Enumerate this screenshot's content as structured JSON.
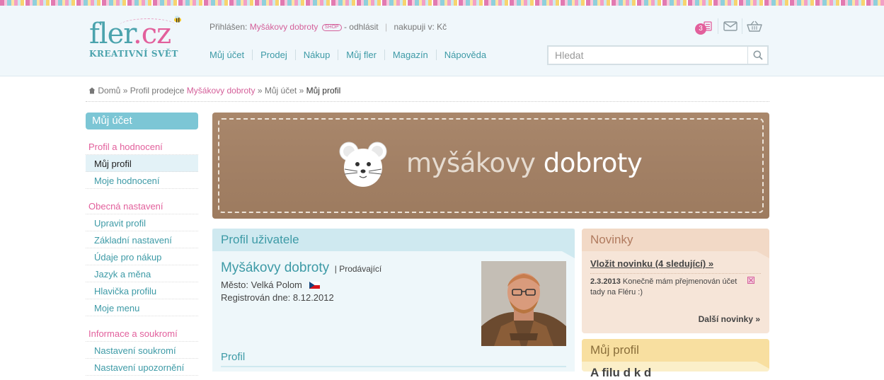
{
  "brand": {
    "logo_main": "fler",
    "logo_dot": ".cz",
    "logo_sub": "KREATIVNÍ SVĚT"
  },
  "loginbar": {
    "label": "Přihlášen:",
    "shop_name": "Myšákovy dobroty",
    "shop_badge": "SHOP",
    "logout": "- odhlásit",
    "currency": "nakupuji v: Kč"
  },
  "mainnav": [
    "Můj účet",
    "Prodej",
    "Nákup",
    "Můj fler",
    "Magazín",
    "Nápověda"
  ],
  "header_icons": {
    "notifications_count": "3",
    "icons": [
      "notifications-icon",
      "mail-icon",
      "basket-icon"
    ]
  },
  "search": {
    "placeholder": "Hledat"
  },
  "breadcrumb": {
    "home": "Domů",
    "sep": "»",
    "item1": "Profil prodejce",
    "item1_link": "Myšákovy dobroty",
    "item2": "Můj účet",
    "current": "Můj profil"
  },
  "sidebar": {
    "title": "Můj účet",
    "sections": [
      {
        "title": "Profil a hodnocení",
        "items": [
          "Můj profil",
          "Moje hodnocení"
        ]
      },
      {
        "title": "Obecná nastavení",
        "items": [
          "Upravit profil",
          "Základní nastavení",
          "Údaje pro nákup",
          "Jazyk a měna",
          "Hlavička profilu",
          "Moje menu"
        ]
      },
      {
        "title": "Informace a soukromí",
        "items": [
          "Nastavení soukromí",
          "Nastavení upozornění"
        ]
      }
    ],
    "active_item": "Můj profil"
  },
  "banner": {
    "text_light": "myšákovy",
    "text_bold": "dobroty"
  },
  "profile": {
    "heading": "Profil uživatele",
    "name": "Myšákovy dobroty",
    "role": "| Prodávající",
    "city": "Město: Velká Polom",
    "registered": "Registrován dne: 8.12.2012",
    "subheading": "Profil"
  },
  "news": {
    "heading": "Novinky",
    "add_label": "Vložit novinku (4 sledující) »",
    "item_date": "2.3.2013",
    "item_text": "Konečně mám přejmenován účet tady na Fléru :)",
    "more": "Další novinky »"
  },
  "my_profile_box": {
    "heading": "Můj profil",
    "cut_text": "A                 filu         d     k       d"
  },
  "colors": {
    "accent": "#3d9aa6",
    "pink": "#e2609c",
    "sidebar_header": "#7cc6d5",
    "news_bg": "#f6e5d8",
    "profile_bg": "#eef7fa"
  }
}
